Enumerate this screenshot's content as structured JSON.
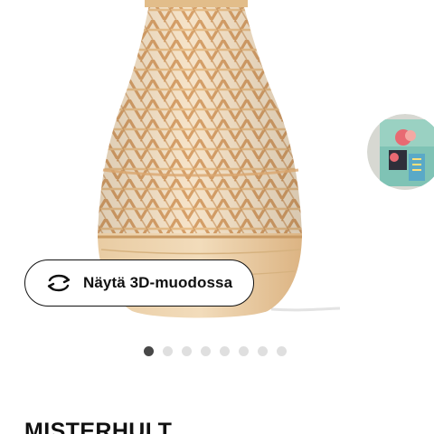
{
  "gallery": {
    "product_image_icon": "bamboo-lamp-image",
    "next_thumbnail_icon": "lamp-packaging-image",
    "view_3d_button": {
      "label": "Näytä 3D-muodossa",
      "icon": "rotate-3d-icon"
    },
    "dots": {
      "count": 8,
      "active_index": 0
    }
  },
  "product": {
    "name": "MISTERHULT"
  },
  "colors": {
    "text": "#111111",
    "dot_active": "#484848",
    "dot_inactive": "#dfdfdf",
    "bamboo": "#e2b17c"
  }
}
